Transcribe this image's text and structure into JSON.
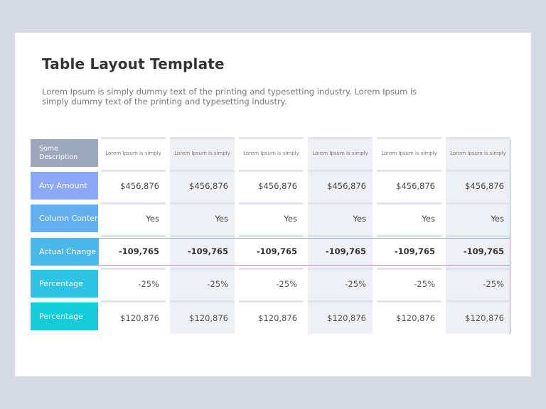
{
  "title": "Table Layout Template",
  "description": "Lorem Ipsum is simply dummy text of the printing and typesetting industry. Lorem Ipsum is simply dummy text of the printing and typesetting industry.",
  "table": {
    "header_label": "Some Description",
    "column_headers": [
      "Lorem Ipsum is simply",
      "Lorem Ipsum is simply",
      "Lorem Ipsum is simply",
      "Lorem Ipsum is simply",
      "Lorem Ipsum is simply",
      "Lorem Ipsum is simply"
    ],
    "rows": [
      {
        "label": "Any Amount",
        "color": "#8ea8f8",
        "values": [
          "$456,876",
          "$456,876",
          "$456,876",
          "$456,876",
          "$456,876",
          "$456,876"
        ]
      },
      {
        "label": "Column Content",
        "color": "#63aff0",
        "values": [
          "Yes",
          "Yes",
          "Yes",
          "Yes",
          "Yes",
          "Yes"
        ]
      },
      {
        "label": "Actual Change",
        "color": "#4ab8e8",
        "values": [
          "-109,765",
          "-109,765",
          "-109,765",
          "-109,765",
          "-109,765",
          "-109,765"
        ]
      },
      {
        "label": "Percentage",
        "color": "#2ec4e3",
        "values": [
          "-25%",
          "-25%",
          "-25%",
          "-25%",
          "-25%",
          "-25%"
        ]
      },
      {
        "label": "Percentage",
        "color": "#15cad9",
        "values": [
          "$120,876",
          "$120,876",
          "$120,876",
          "$120,876",
          "$120,876",
          "$120,876"
        ]
      }
    ],
    "header_color": "#9ea8bd"
  }
}
